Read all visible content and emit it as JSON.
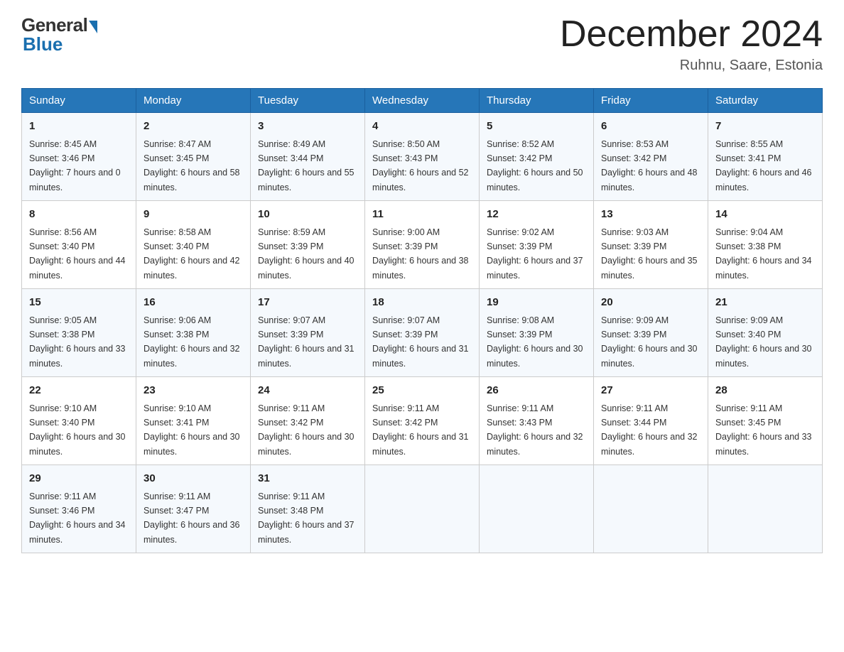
{
  "header": {
    "logo_general": "General",
    "logo_blue": "Blue",
    "month_title": "December 2024",
    "location": "Ruhnu, Saare, Estonia"
  },
  "days_of_week": [
    "Sunday",
    "Monday",
    "Tuesday",
    "Wednesday",
    "Thursday",
    "Friday",
    "Saturday"
  ],
  "weeks": [
    [
      {
        "day": "1",
        "sunrise": "8:45 AM",
        "sunset": "3:46 PM",
        "daylight": "7 hours and 0 minutes."
      },
      {
        "day": "2",
        "sunrise": "8:47 AM",
        "sunset": "3:45 PM",
        "daylight": "6 hours and 58 minutes."
      },
      {
        "day": "3",
        "sunrise": "8:49 AM",
        "sunset": "3:44 PM",
        "daylight": "6 hours and 55 minutes."
      },
      {
        "day": "4",
        "sunrise": "8:50 AM",
        "sunset": "3:43 PM",
        "daylight": "6 hours and 52 minutes."
      },
      {
        "day": "5",
        "sunrise": "8:52 AM",
        "sunset": "3:42 PM",
        "daylight": "6 hours and 50 minutes."
      },
      {
        "day": "6",
        "sunrise": "8:53 AM",
        "sunset": "3:42 PM",
        "daylight": "6 hours and 48 minutes."
      },
      {
        "day": "7",
        "sunrise": "8:55 AM",
        "sunset": "3:41 PM",
        "daylight": "6 hours and 46 minutes."
      }
    ],
    [
      {
        "day": "8",
        "sunrise": "8:56 AM",
        "sunset": "3:40 PM",
        "daylight": "6 hours and 44 minutes."
      },
      {
        "day": "9",
        "sunrise": "8:58 AM",
        "sunset": "3:40 PM",
        "daylight": "6 hours and 42 minutes."
      },
      {
        "day": "10",
        "sunrise": "8:59 AM",
        "sunset": "3:39 PM",
        "daylight": "6 hours and 40 minutes."
      },
      {
        "day": "11",
        "sunrise": "9:00 AM",
        "sunset": "3:39 PM",
        "daylight": "6 hours and 38 minutes."
      },
      {
        "day": "12",
        "sunrise": "9:02 AM",
        "sunset": "3:39 PM",
        "daylight": "6 hours and 37 minutes."
      },
      {
        "day": "13",
        "sunrise": "9:03 AM",
        "sunset": "3:39 PM",
        "daylight": "6 hours and 35 minutes."
      },
      {
        "day": "14",
        "sunrise": "9:04 AM",
        "sunset": "3:38 PM",
        "daylight": "6 hours and 34 minutes."
      }
    ],
    [
      {
        "day": "15",
        "sunrise": "9:05 AM",
        "sunset": "3:38 PM",
        "daylight": "6 hours and 33 minutes."
      },
      {
        "day": "16",
        "sunrise": "9:06 AM",
        "sunset": "3:38 PM",
        "daylight": "6 hours and 32 minutes."
      },
      {
        "day": "17",
        "sunrise": "9:07 AM",
        "sunset": "3:39 PM",
        "daylight": "6 hours and 31 minutes."
      },
      {
        "day": "18",
        "sunrise": "9:07 AM",
        "sunset": "3:39 PM",
        "daylight": "6 hours and 31 minutes."
      },
      {
        "day": "19",
        "sunrise": "9:08 AM",
        "sunset": "3:39 PM",
        "daylight": "6 hours and 30 minutes."
      },
      {
        "day": "20",
        "sunrise": "9:09 AM",
        "sunset": "3:39 PM",
        "daylight": "6 hours and 30 minutes."
      },
      {
        "day": "21",
        "sunrise": "9:09 AM",
        "sunset": "3:40 PM",
        "daylight": "6 hours and 30 minutes."
      }
    ],
    [
      {
        "day": "22",
        "sunrise": "9:10 AM",
        "sunset": "3:40 PM",
        "daylight": "6 hours and 30 minutes."
      },
      {
        "day": "23",
        "sunrise": "9:10 AM",
        "sunset": "3:41 PM",
        "daylight": "6 hours and 30 minutes."
      },
      {
        "day": "24",
        "sunrise": "9:11 AM",
        "sunset": "3:42 PM",
        "daylight": "6 hours and 30 minutes."
      },
      {
        "day": "25",
        "sunrise": "9:11 AM",
        "sunset": "3:42 PM",
        "daylight": "6 hours and 31 minutes."
      },
      {
        "day": "26",
        "sunrise": "9:11 AM",
        "sunset": "3:43 PM",
        "daylight": "6 hours and 32 minutes."
      },
      {
        "day": "27",
        "sunrise": "9:11 AM",
        "sunset": "3:44 PM",
        "daylight": "6 hours and 32 minutes."
      },
      {
        "day": "28",
        "sunrise": "9:11 AM",
        "sunset": "3:45 PM",
        "daylight": "6 hours and 33 minutes."
      }
    ],
    [
      {
        "day": "29",
        "sunrise": "9:11 AM",
        "sunset": "3:46 PM",
        "daylight": "6 hours and 34 minutes."
      },
      {
        "day": "30",
        "sunrise": "9:11 AM",
        "sunset": "3:47 PM",
        "daylight": "6 hours and 36 minutes."
      },
      {
        "day": "31",
        "sunrise": "9:11 AM",
        "sunset": "3:48 PM",
        "daylight": "6 hours and 37 minutes."
      },
      null,
      null,
      null,
      null
    ]
  ]
}
